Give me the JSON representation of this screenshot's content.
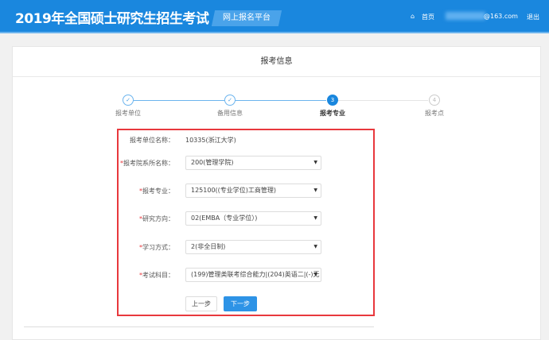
{
  "header": {
    "title": "2019年全国硕士研究生招生考试",
    "platform": "网上报名平台",
    "home": "首页",
    "email": "@163.com",
    "logout": "退出"
  },
  "card": {
    "title": "报考信息"
  },
  "steps": [
    {
      "num": "✓",
      "label": "报考单位",
      "state": "done"
    },
    {
      "num": "✓",
      "label": "备用信息",
      "state": "done"
    },
    {
      "num": "3",
      "label": "报考专业",
      "state": "active"
    },
    {
      "num": "4",
      "label": "报考点",
      "state": "todo"
    }
  ],
  "form": {
    "unit": {
      "label": "报考单位名称：",
      "value": "10335(浙江大学)"
    },
    "fields": [
      {
        "label": "报考院系所名称：",
        "value": "200(管理学院)"
      },
      {
        "label": "报考专业：",
        "value": "125100((专业学位)工商管理)"
      },
      {
        "label": "研究方向：",
        "value": "02(EMBA（专业学位）)"
      },
      {
        "label": "学习方式：",
        "value": "2(非全日制)"
      },
      {
        "label": "考试科目：",
        "value": "(199)管理类联考综合能力|(204)英语二|(-)无"
      }
    ],
    "required_mark": "*",
    "prev": "上一步",
    "next": "下一步"
  },
  "colors": {
    "brand": "#1a87de",
    "highlight": "#e8383d"
  }
}
